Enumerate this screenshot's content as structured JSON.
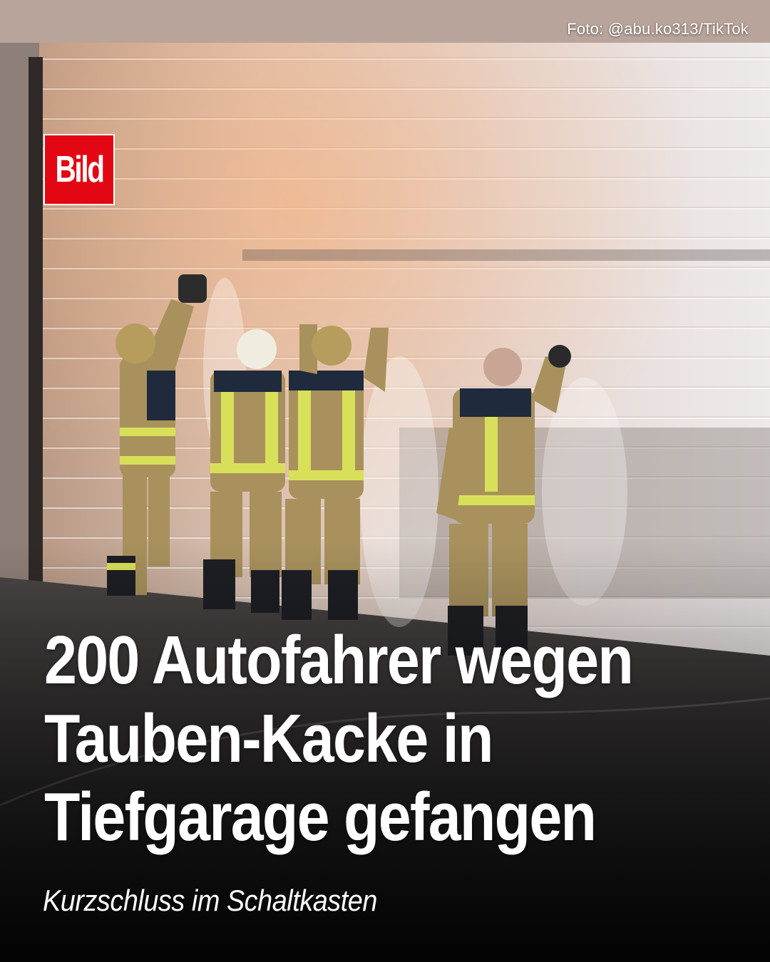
{
  "post": {
    "photo_credit": "Foto: @abu.ko313/TikTok",
    "brand_logo": "Bild",
    "headline_lines": [
      "200 Autofahrer wegen",
      "Tauben-Kacke in",
      "Tiefgarage gefangen"
    ],
    "subheadline": "Kurzschluss im Schaltkasten"
  },
  "colors": {
    "brand_red": "#e30613",
    "headline_text": "#ffffff",
    "uniform_beige": "#a8915c",
    "reflective_stripe": "#d8e05a"
  }
}
